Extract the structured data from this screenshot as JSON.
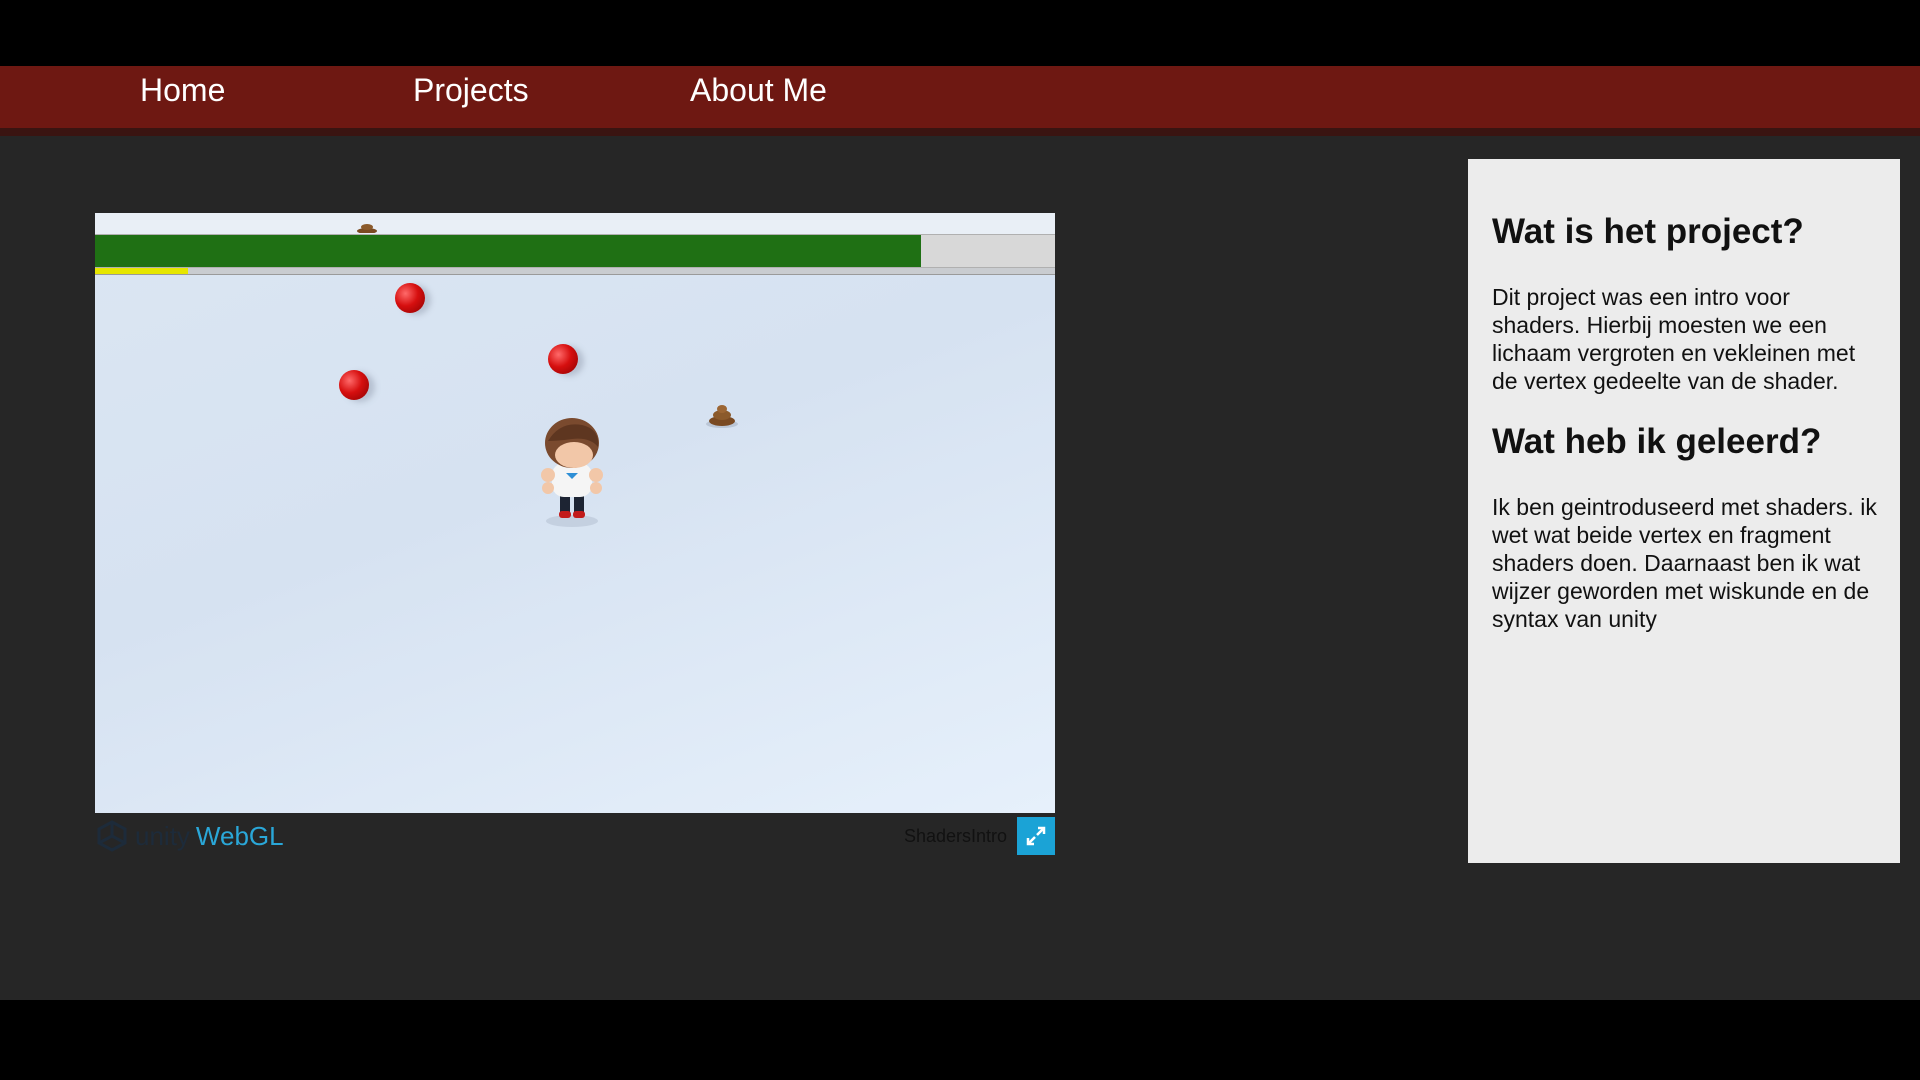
{
  "nav": {
    "items": [
      {
        "label": "Home"
      },
      {
        "label": "Projects"
      },
      {
        "label": "About Me"
      }
    ],
    "background_color": "#6e1812"
  },
  "game": {
    "health_fraction": 0.86,
    "xp_fraction": 0.097,
    "health_color": "#1f7014",
    "xp_color": "#e6e600",
    "objects": [
      {
        "kind": "apple"
      },
      {
        "kind": "apple"
      },
      {
        "kind": "apple"
      },
      {
        "kind": "poop"
      },
      {
        "kind": "poop"
      }
    ],
    "footer": {
      "unity_label": "unity",
      "webgl_label": "WebGL",
      "title": "ShadersIntro",
      "fullscreen_icon": "expand-arrows-icon"
    }
  },
  "panel": {
    "heading_1": "Wat is het project?",
    "text_1": "Dit project was een intro voor shaders. Hierbij moesten we een lichaam vergroten en vekleinen met de vertex gedeelte van de shader.",
    "heading_2": "Wat heb ik geleerd?",
    "text_2": "Ik ben geintroduseerd met shaders. ik wet wat beide vertex en fragment shaders doen. Daarnaast ben ik wat wijzer geworden met wiskunde en de syntax van unity"
  }
}
